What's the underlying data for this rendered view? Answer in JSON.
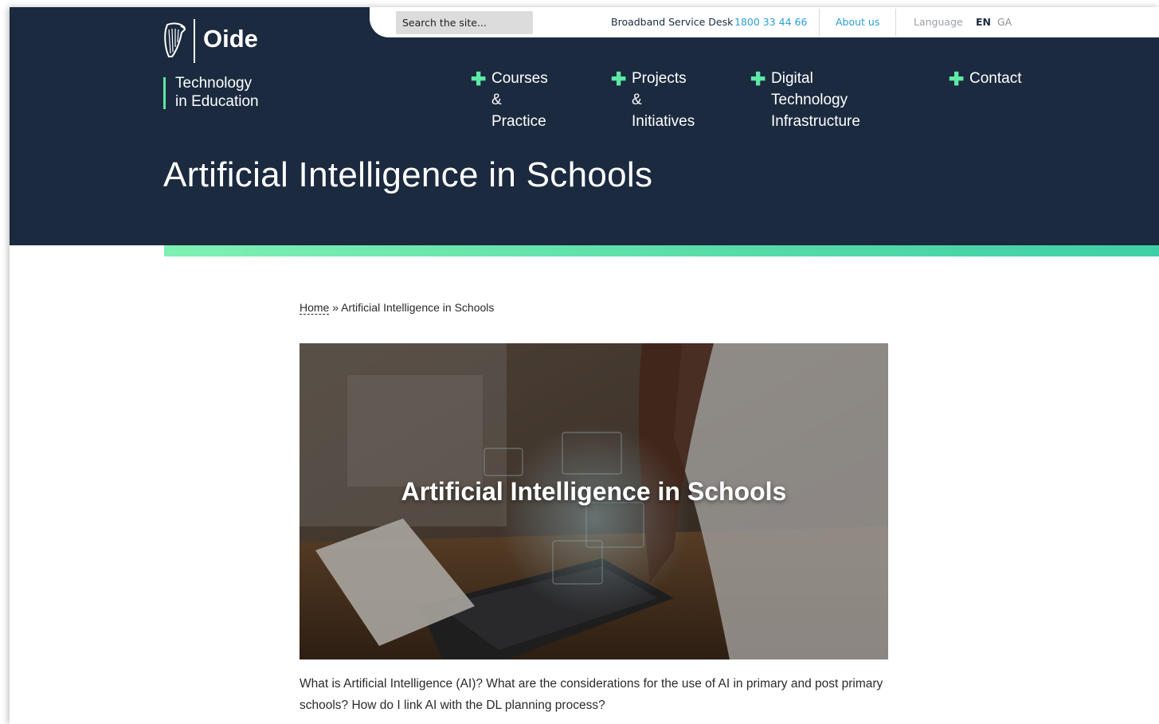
{
  "header": {
    "search": {
      "placeholder": "Search the site..."
    },
    "service_desk": {
      "label": "Broadband Service Desk",
      "phone": "1800 33 44 66"
    },
    "about_label": "About us",
    "language": {
      "label": "Language",
      "current": "EN",
      "other": "GA"
    },
    "logo": {
      "name": "Oide",
      "tagline_line1": "Technology",
      "tagline_line2": "in Education"
    },
    "nav": [
      {
        "label": "Courses &\nPractice",
        "icon": "plus-icon"
      },
      {
        "label": "Projects &\nInitiatives",
        "icon": "plus-icon"
      },
      {
        "label": "Digital Technology\nInfrastructure",
        "icon": "plus-icon"
      },
      {
        "label": "Contact",
        "icon": "plus-icon"
      }
    ],
    "title": "Artificial Intelligence in Schools"
  },
  "breadcrumb": {
    "home": "Home",
    "separator": "»",
    "current": "Artificial Intelligence in Schools"
  },
  "hero": {
    "title": "Artificial Intelligence in Schools"
  },
  "intro": "What is Artificial Intelligence (AI)? What are the considerations for the use of AI in primary and post primary schools? How do I link AI with the DL planning process?",
  "colors": {
    "header_bg": "#1b2a3f",
    "accent_green": "#5ee8a6",
    "link_blue": "#2b9fd3"
  }
}
